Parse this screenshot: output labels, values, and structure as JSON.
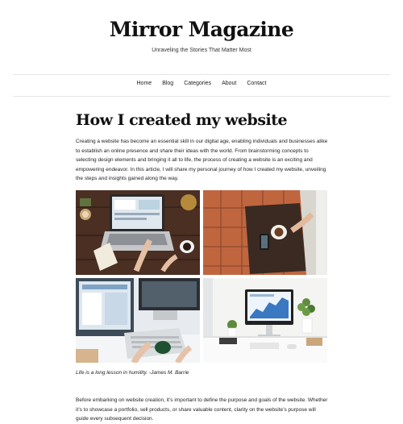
{
  "site": {
    "title": "Mirror Magazine",
    "tagline": "Unraveling the Stories That Matter Most"
  },
  "nav": [
    "Home",
    "Blog",
    "Categories",
    "About",
    "Contact"
  ],
  "post": {
    "title": "How I created my website",
    "intro": "Creating a website has become an essential skill in our digital age, enabling individuals and businesses alike to establish an online presence and share their ideas with the world. From brainstorming concepts to selecting design elements and bringing it all to life, the process of creating a website is an exciting and empowering endeavor. In this article, I will share my personal journey of how I created my website, unveiling the steps and insights gained along the way.",
    "caption": "Life is a long lesson in humility. -James M. Barrie",
    "paragraph": "Before embarking on website creation, it’s important to define the purpose and goals of the website. Whether it’s to showcase a portfolio, sell products, or share valuable content, clarity on the website’s purpose will guide every subsequent decision."
  },
  "colors": {
    "text": "#1a1a1a",
    "rule": "#e6e6e6",
    "wood": "#4a2f22",
    "terracotta": "#c0663f"
  }
}
